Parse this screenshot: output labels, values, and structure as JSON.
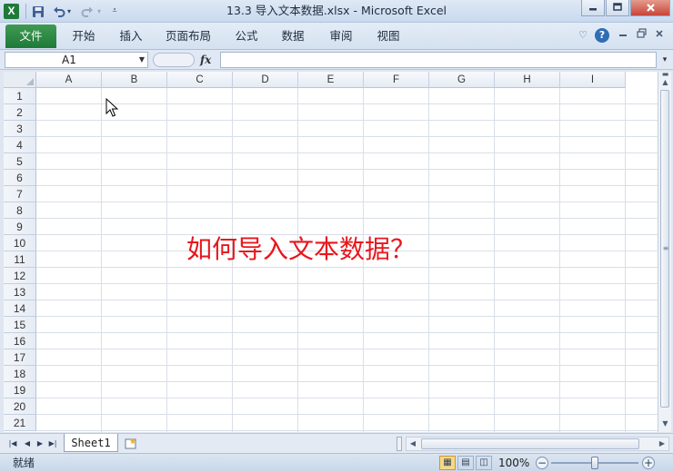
{
  "window": {
    "title": "13.3 导入文本数据.xlsx  -  Microsoft Excel",
    "app_icon_letter": "X"
  },
  "qat": {
    "save_icon": "save-icon",
    "undo_icon": "undo-icon",
    "redo_icon": "redo-icon",
    "customize_icon": "customize-icon"
  },
  "ribbon": {
    "file_tab": "文件",
    "tabs": [
      "开始",
      "插入",
      "页面布局",
      "公式",
      "数据",
      "审阅",
      "视图"
    ]
  },
  "formula_bar": {
    "name_box": "A1",
    "fx_label": "fx",
    "formula_value": ""
  },
  "sheet": {
    "columns": [
      "A",
      "B",
      "C",
      "D",
      "E",
      "F",
      "G",
      "H",
      "I"
    ],
    "rows": [
      "1",
      "2",
      "3",
      "4",
      "5",
      "6",
      "7",
      "8",
      "9",
      "10",
      "11",
      "12",
      "13",
      "14",
      "15",
      "16",
      "17",
      "18",
      "19",
      "20",
      "21"
    ],
    "overlay_text": "如何导入文本数据？"
  },
  "tabs": {
    "sheet_names": [
      "Sheet1"
    ]
  },
  "status": {
    "ready_text": "就绪",
    "zoom": "100%",
    "zoom_fraction": 0.5
  },
  "colors": {
    "file_tab": "#1f7a3a",
    "overlay_text": "#e8161c"
  }
}
